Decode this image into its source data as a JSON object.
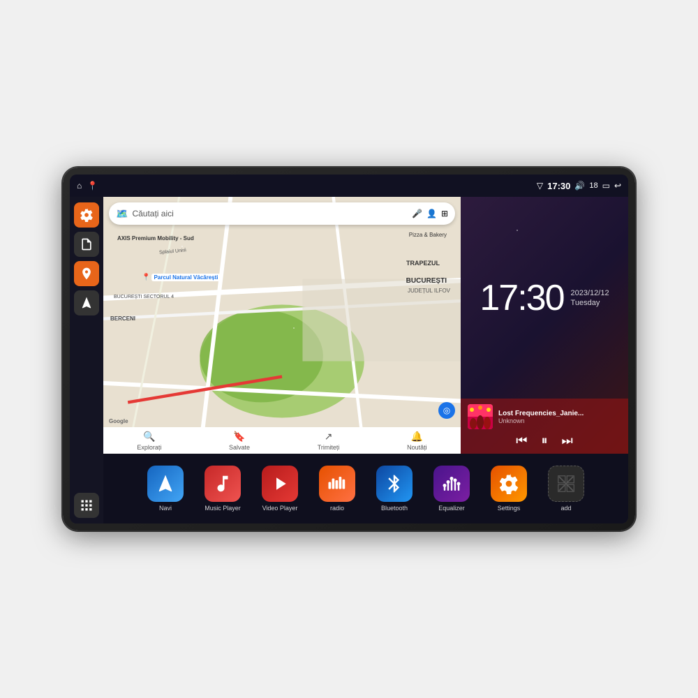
{
  "device": {
    "status_bar": {
      "left_icons": [
        "home",
        "location"
      ],
      "time": "17:30",
      "right_icons": [
        "wifi",
        "volume",
        "battery_18",
        "battery",
        "back"
      ]
    }
  },
  "sidebar": {
    "buttons": [
      {
        "icon": "settings",
        "color": "orange",
        "label": "Settings"
      },
      {
        "icon": "file",
        "color": "dark",
        "label": "Files"
      },
      {
        "icon": "map",
        "color": "orange",
        "label": "Maps"
      },
      {
        "icon": "navigation",
        "color": "dark",
        "label": "Navigation"
      },
      {
        "icon": "grid",
        "color": "dark",
        "label": "All Apps"
      }
    ]
  },
  "map": {
    "search_placeholder": "Căutați aici",
    "location_label": "Parcul Natural Văcărești",
    "area_label": "BUCUREȘTI",
    "district_label": "JUDEȚUL ILFOV",
    "sector_label": "BUCUREȘTI SECTORUL 4",
    "berceni_label": "BERCENI",
    "axis_label": "AXIS Premium Mobility - Sud",
    "pizza_label": "Pizza & Bakery",
    "splai_label": "Splaiul Unirii",
    "bottom_items": [
      {
        "label": "Explorați",
        "icon": "explore"
      },
      {
        "label": "Salvate",
        "icon": "bookmark"
      },
      {
        "label": "Trimiteți",
        "icon": "send"
      },
      {
        "label": "Noutăți",
        "icon": "bell"
      }
    ]
  },
  "clock": {
    "time": "17:30",
    "date": "2023/12/12",
    "day": "Tuesday"
  },
  "music": {
    "title": "Lost Frequencies_Janie...",
    "artist": "Unknown",
    "controls": [
      "prev",
      "pause",
      "next"
    ]
  },
  "apps": [
    {
      "label": "Navi",
      "icon": "navigation",
      "color": "blue"
    },
    {
      "label": "Music Player",
      "icon": "music",
      "color": "red"
    },
    {
      "label": "Video Player",
      "icon": "video",
      "color": "red2"
    },
    {
      "label": "radio",
      "icon": "radio",
      "color": "orange"
    },
    {
      "label": "Bluetooth",
      "icon": "bluetooth",
      "color": "blue2"
    },
    {
      "label": "Equalizer",
      "icon": "equalizer",
      "color": "purple"
    },
    {
      "label": "Settings",
      "icon": "settings",
      "color": "orange2"
    },
    {
      "label": "add",
      "icon": "add",
      "color": "dark"
    }
  ]
}
